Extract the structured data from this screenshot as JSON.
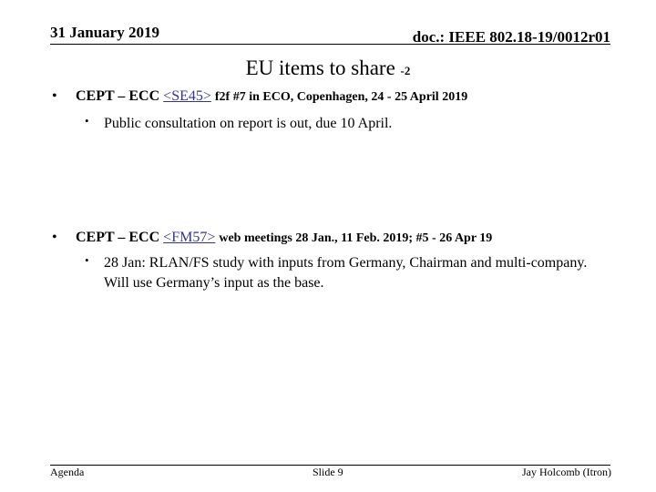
{
  "header": {
    "date": "31 January 2019",
    "doc_id": "doc.: IEEE 802.18-19/0012r01"
  },
  "title": {
    "main": "EU items to share",
    "suffix": "-2"
  },
  "bullets": [
    {
      "bullet": "•",
      "lead": "CEPT – ECC",
      "link": "<SE45>",
      "rest": "f2f  #7 in ECO, Copenhagen, 24 - 25 April 2019",
      "sub": [
        {
          "bullet": "•",
          "text": "Public consultation on report is out, due 10 April."
        }
      ]
    },
    {
      "bullet": "•",
      "lead": "CEPT – ECC",
      "link": "<FM57>",
      "rest": "web meetings  28 Jan., 11 Feb. 2019;  #5  -  26 Apr 19",
      "sub": [
        {
          "bullet": "•",
          "text": "28 Jan: RLAN/FS study with inputs from Germany, Chairman and multi-company.  Will use Germany’s input as the base."
        }
      ]
    }
  ],
  "footer": {
    "left": "Agenda",
    "center": "Slide 9",
    "right": "Jay Holcomb (Itron)"
  },
  "colors": {
    "link": "#333399",
    "text": "#000000",
    "background": "#ffffff"
  }
}
